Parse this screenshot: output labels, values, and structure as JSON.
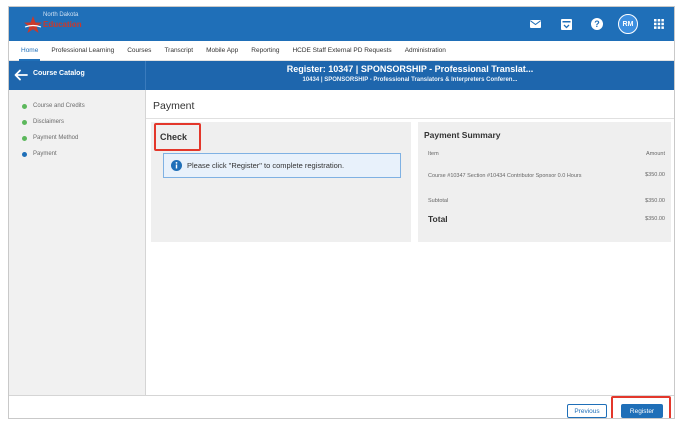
{
  "brand": {
    "logo_line1": "North Dakota",
    "logo_line2": "Education"
  },
  "user": {
    "initials": "RM"
  },
  "nav": {
    "items": [
      {
        "label": "Home",
        "active": true
      },
      {
        "label": "Professional Learning",
        "active": false
      },
      {
        "label": "Courses",
        "active": false
      },
      {
        "label": "Transcript",
        "active": false
      },
      {
        "label": "Mobile App",
        "active": false
      },
      {
        "label": "Reporting",
        "active": false
      },
      {
        "label": "HCDE Staff External PD Requests",
        "active": false
      },
      {
        "label": "Administration",
        "active": false
      }
    ]
  },
  "header": {
    "back_label": "Course Catalog",
    "title": "Register: 10347 | SPONSORSHIP - Professional Translat...",
    "subtitle": "10434 | SPONSORSHIP - Professional Translators & Interpreters Conferen..."
  },
  "sidebar": {
    "steps": [
      {
        "label": "Course and Credits",
        "status": "complete"
      },
      {
        "label": "Disclaimers",
        "status": "complete"
      },
      {
        "label": "Payment Method",
        "status": "complete"
      },
      {
        "label": "Payment",
        "status": "current"
      }
    ]
  },
  "main": {
    "page_title": "Payment",
    "check": {
      "title": "Check",
      "info_message": "Please click \"Register\" to complete registration."
    },
    "summary": {
      "title": "Payment Summary",
      "col_item": "Item",
      "col_amount": "Amount",
      "line_item": "Course #10347 Section #10434 Contributor Sponsor 0.0 Hours",
      "line_amount": "$350.00",
      "subtotal_label": "Subtotal",
      "subtotal_amount": "$350.00",
      "total_label": "Total",
      "total_amount": "$350.00"
    }
  },
  "footer": {
    "previous_label": "Previous",
    "register_label": "Register"
  },
  "colors": {
    "primary": "#1f6fb8",
    "header": "#1e66ad",
    "complete_dot": "#5cb85c",
    "current_dot": "#1f6fb8",
    "highlight": "#e3372b"
  }
}
